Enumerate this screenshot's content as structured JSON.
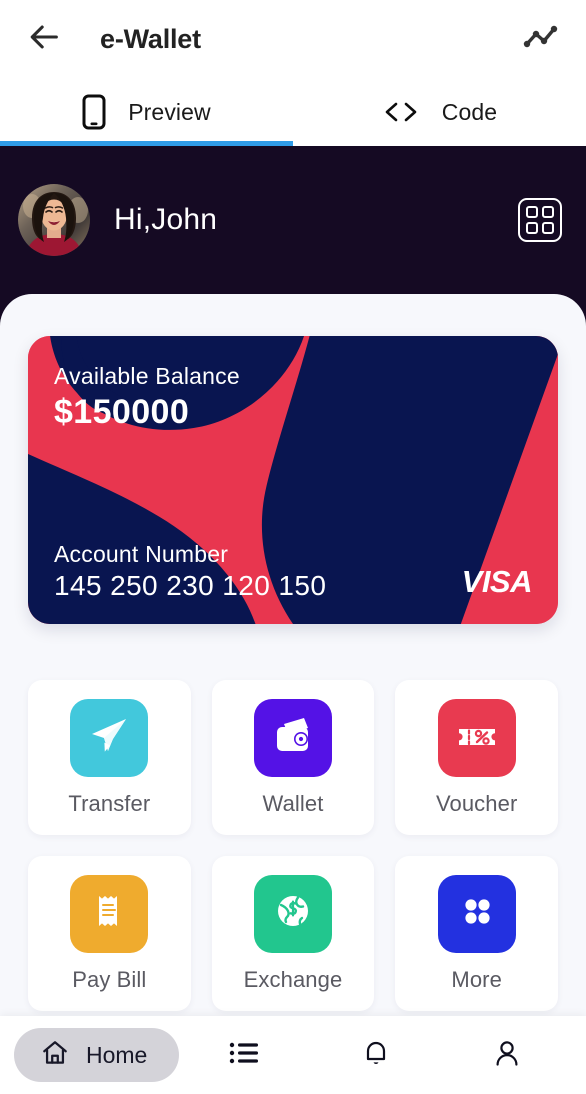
{
  "appbar": {
    "title": "e-Wallet",
    "back_icon": "arrow-left-icon",
    "action_icon": "activity-chart-icon"
  },
  "tabs": {
    "accent_color": "#2f9ce8",
    "items": [
      {
        "label": "Preview",
        "icon": "mobile-phone-icon",
        "active": true
      },
      {
        "label": "Code",
        "icon": "code-brackets-icon",
        "active": false
      }
    ]
  },
  "phone": {
    "header_bg": "#150a23",
    "sheet_bg": "#f7f8fc",
    "greeting": "Hi,John",
    "avatar_icon": "user-photo-avatar",
    "grid_button_icon": "grid-menu-icon"
  },
  "card": {
    "balance_label": "Available Balance",
    "balance_value": "$150000",
    "account_label": "Account Number",
    "account_number": "145 250 230 120 150",
    "brand": "VISA",
    "color_red": "#e8364f",
    "color_navy": "#091550"
  },
  "actions": [
    {
      "label": "Transfer",
      "icon": "paper-plane-icon",
      "color": "#42c8dc"
    },
    {
      "label": "Wallet",
      "icon": "wallet-icon",
      "color": "#5412e6"
    },
    {
      "label": "Voucher",
      "icon": "ticket-percent-icon",
      "color": "#e83a50"
    },
    {
      "label": "Pay Bill",
      "icon": "receipt-icon",
      "color": "#efab2e"
    },
    {
      "label": "Exchange",
      "icon": "globe-dollar-icon",
      "color": "#22c68e"
    },
    {
      "label": "More",
      "icon": "four-dots-icon",
      "color": "#2331e0"
    }
  ],
  "bottomnav": {
    "home_label": "Home",
    "home_icon": "home-icon",
    "pill_color": "#d4d3d9",
    "items": [
      {
        "icon": "list-icon"
      },
      {
        "icon": "bell-icon"
      },
      {
        "icon": "person-icon"
      }
    ]
  }
}
